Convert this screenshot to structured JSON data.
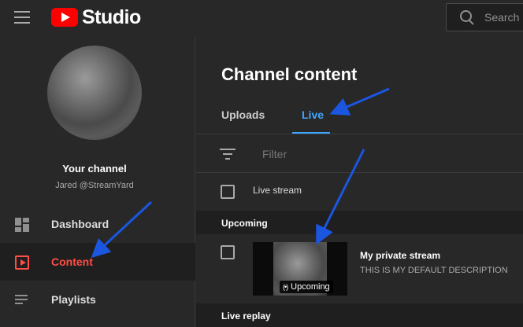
{
  "header": {
    "app_name": "Studio",
    "search_placeholder": "Search"
  },
  "sidebar": {
    "channel_title": "Your channel",
    "channel_handle": "Jared @StreamYard",
    "items": [
      {
        "label": "Dashboard",
        "icon": "dashboard-icon",
        "active": false
      },
      {
        "label": "Content",
        "icon": "content-icon",
        "active": true
      },
      {
        "label": "Playlists",
        "icon": "playlists-icon",
        "active": false
      }
    ]
  },
  "main": {
    "title": "Channel content",
    "tabs": [
      {
        "label": "Uploads",
        "active": false
      },
      {
        "label": "Live",
        "active": true
      }
    ],
    "filter_placeholder": "Filter",
    "column_header": "Live stream",
    "sections": {
      "upcoming": "Upcoming",
      "live_replay": "Live replay"
    },
    "rows": [
      {
        "title": "My private stream",
        "description": "THIS IS MY DEFAULT DESCRIPTION",
        "status_badge": "Upcoming"
      }
    ]
  },
  "colors": {
    "background": "#282828",
    "accent_red": "#ff4e45",
    "accent_blue": "#3ea6ff",
    "annotation_arrow": "#1a56e0"
  }
}
